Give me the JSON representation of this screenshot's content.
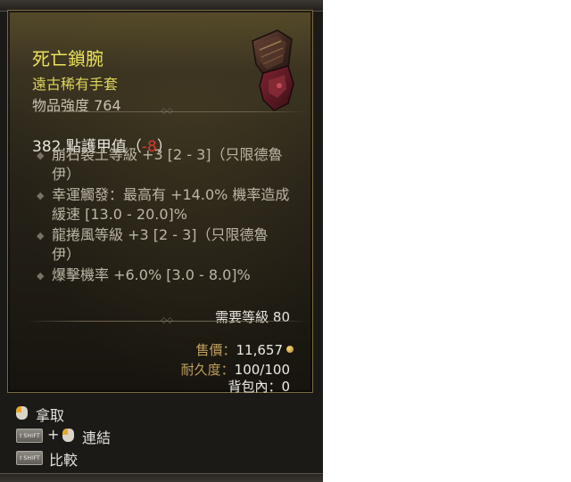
{
  "item": {
    "name": "死亡鎖腕",
    "type": "遠古稀有手套",
    "power": "物品強度 764"
  },
  "stats": {
    "armor_prefix": "382 點護甲值（",
    "armor_delta": "-8",
    "armor_suffix": "）"
  },
  "affixes": [
    {
      "line1": "崩石裂土等級 +3 [2 - 3]（只限德魯",
      "line2": "伊）"
    },
    {
      "line1": "幸運觸發：最高有 +14.0% 機率造成",
      "line2": "緩速 [13.0 - 20.0]%"
    },
    {
      "line1": "龍捲風等級 +3 [2 - 3]（只限德魯",
      "line2": "伊）"
    },
    {
      "line1": "爆擊機率 +6.0% [3.0 - 8.0]%",
      "line2": ""
    }
  ],
  "footer": {
    "required_level": "需要等級 80",
    "sell_label": "售價：",
    "sell_value": "11,657",
    "durability_label": "耐久度：",
    "durability_value": "100/100",
    "inventory_label": "背包內：",
    "inventory_value": "0"
  },
  "actions": {
    "pickup": "拿取",
    "plus": "+",
    "link": "連結",
    "compare": "比較",
    "shift_key": "⇧SHIFT"
  },
  "icons": {
    "item": "gauntlet-icon",
    "gold": "gold-coin-icon",
    "mouse": "mouse-left-click-icon",
    "shift": "shift-key-icon"
  },
  "colors": {
    "item_name": "#ece35c",
    "item_type": "#ddd55b",
    "armor_delta": "#d83a30",
    "label_gold": "#c0a15c"
  }
}
